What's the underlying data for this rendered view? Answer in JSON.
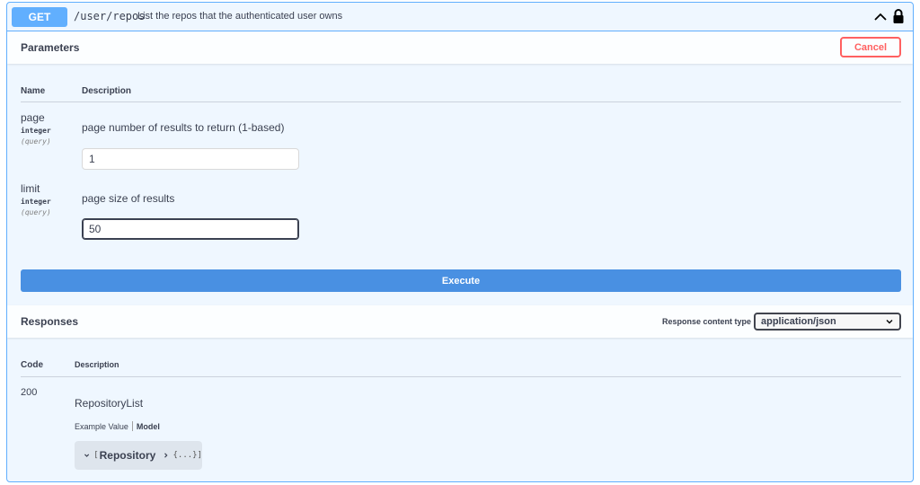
{
  "operation": {
    "method": "GET",
    "path": "/user/repos",
    "summary": "List the repos that the authenticated user owns"
  },
  "parameters": {
    "title": "Parameters",
    "cancel_label": "Cancel",
    "col_name": "Name",
    "col_description": "Description",
    "items": [
      {
        "name": "page",
        "type": "integer",
        "in": "(query)",
        "description": "page number of results to return (1-based)",
        "value": "1"
      },
      {
        "name": "limit",
        "type": "integer",
        "in": "(query)",
        "description": "page size of results",
        "value": "50"
      }
    ],
    "execute_label": "Execute"
  },
  "responses": {
    "title": "Responses",
    "content_type_label": "Response content type",
    "content_type_value": "application/json",
    "col_code": "Code",
    "col_description": "Description",
    "rows": [
      {
        "code": "200",
        "model_name": "RepositoryList",
        "tab_example": "Example Value",
        "tab_model": "Model",
        "model_bracket_open": "[",
        "model_title": "Repository",
        "model_ellipsis": "{...}]"
      }
    ]
  },
  "colors": {
    "get": "#61affe",
    "execute": "#4990e2",
    "cancel": "#ff6060"
  }
}
